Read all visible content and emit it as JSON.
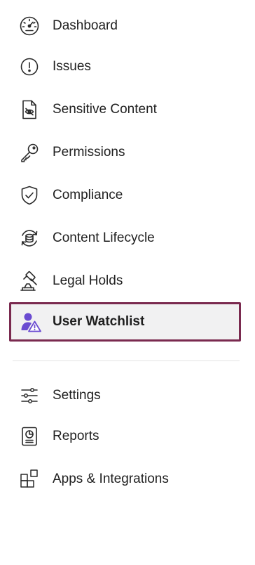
{
  "nav": {
    "items": [
      {
        "label": "Dashboard",
        "icon": "dashboard-icon"
      },
      {
        "label": "Issues",
        "icon": "issues-icon"
      },
      {
        "label": "Sensitive Content",
        "icon": "sensitive-content-icon"
      },
      {
        "label": "Permissions",
        "icon": "key-icon"
      },
      {
        "label": "Compliance",
        "icon": "shield-check-icon"
      },
      {
        "label": "Content Lifecycle",
        "icon": "lifecycle-icon"
      },
      {
        "label": "Legal Holds",
        "icon": "gavel-icon"
      },
      {
        "label": "User Watchlist",
        "icon": "user-warning-icon",
        "active": true
      }
    ],
    "secondary_items": [
      {
        "label": "Settings",
        "icon": "sliders-icon"
      },
      {
        "label": "Reports",
        "icon": "report-icon"
      },
      {
        "label": "Apps & Integrations",
        "icon": "apps-icon"
      }
    ]
  },
  "colors": {
    "active_border": "#7a2a4f",
    "active_background": "#f1f1f2",
    "active_icon": "#6a4bd1",
    "text": "#1f1f1f",
    "icon_stroke": "#2a2a2a"
  }
}
